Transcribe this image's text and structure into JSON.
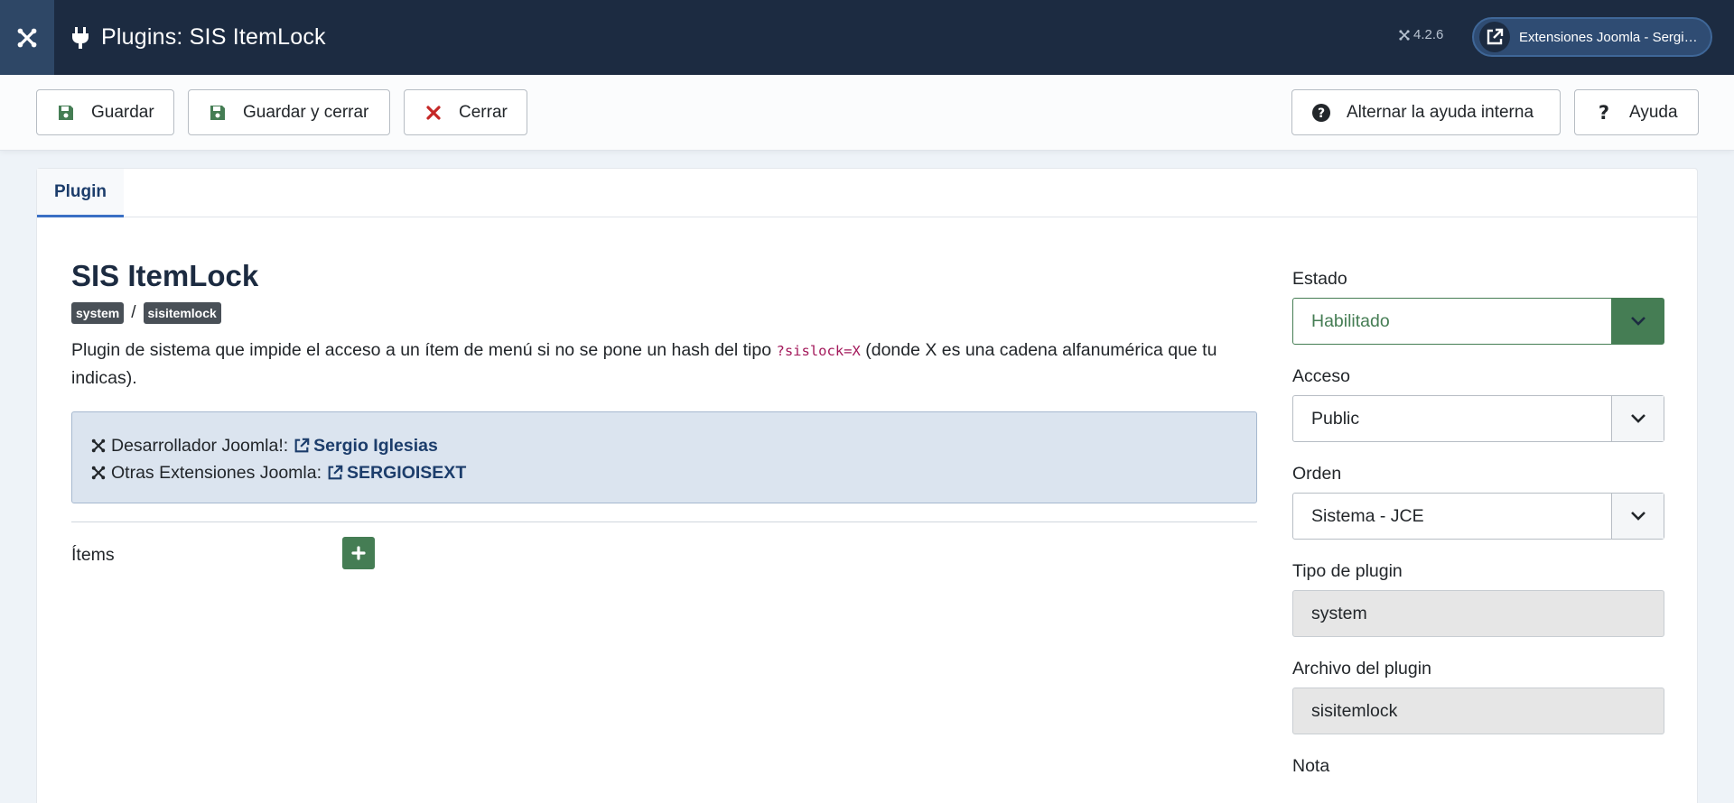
{
  "header": {
    "title": "Plugins: SIS ItemLock",
    "version": "4.2.6",
    "site_button": "Extensiones Joomla - Sergio..."
  },
  "toolbar": {
    "save": "Guardar",
    "save_close": "Guardar y cerrar",
    "close": "Cerrar",
    "toggle_help": "Alternar la ayuda interna",
    "help": "Ayuda"
  },
  "tabs": [
    {
      "label": "Plugin"
    }
  ],
  "plugin": {
    "name": "SIS ItemLock",
    "folder": "system",
    "element": "sisitemlock",
    "description_before": "Plugin de sistema que impide el acceso a un ítem de menú si no se pone un hash del tipo ",
    "description_code": "?sislock=X",
    "description_after": " (donde X es una cadena alfanumérica que tu indicas).",
    "developer_label": "Desarrollador Joomla!:",
    "developer_name": "Sergio Iglesias",
    "extensions_label": "Otras Extensiones Joomla:",
    "extensions_name": "SERGIOISEXT",
    "items_label": "Ítems"
  },
  "sidebar": {
    "estado_label": "Estado",
    "estado_value": "Habilitado",
    "acceso_label": "Acceso",
    "acceso_value": "Public",
    "orden_label": "Orden",
    "orden_value": "Sistema - JCE",
    "tipo_label": "Tipo de plugin",
    "tipo_value": "system",
    "archivo_label": "Archivo del plugin",
    "archivo_value": "sisitemlock",
    "nota_label": "Nota"
  },
  "colors": {
    "header_bg": "#1c2b41",
    "success": "#457d54",
    "danger": "#c52827",
    "link": "#1c3d6b",
    "info_bg": "#dbe4ef"
  },
  "icons": {
    "logo": "joomla-icon",
    "plug": "plug-icon",
    "save": "save-icon",
    "close": "times-icon",
    "help": "question-circle-icon",
    "help2": "question-icon",
    "external": "external-link-icon",
    "chevron": "chevron-down-icon",
    "add": "plus-icon"
  }
}
